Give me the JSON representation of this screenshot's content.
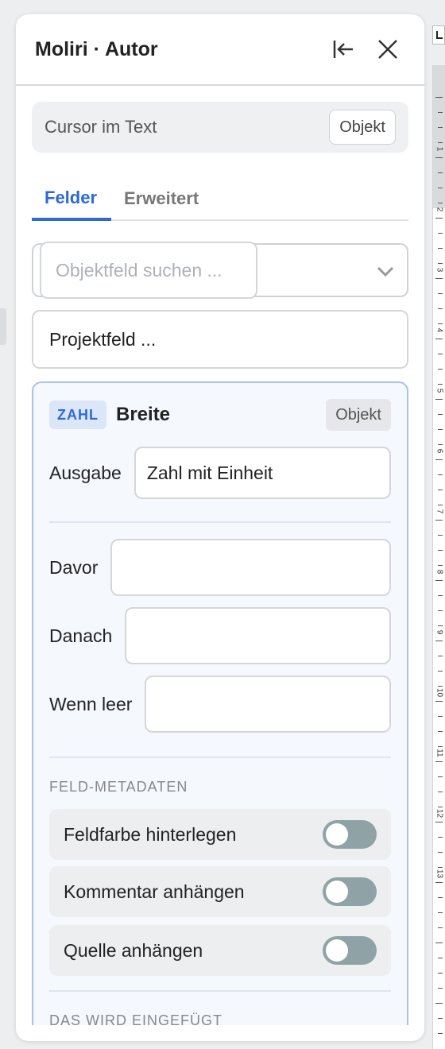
{
  "panel": {
    "title": "Moliri · Autor",
    "context_text": "Cursor im Text",
    "context_button": "Objekt"
  },
  "tabs": [
    {
      "label": "Felder",
      "active": true
    },
    {
      "label": "Erweitert",
      "active": false
    }
  ],
  "search": {
    "placeholder": "Objektfeld suchen ..."
  },
  "project_field": {
    "placeholder": "Projektfeld ..."
  },
  "field_card": {
    "type_badge": "ZAHL",
    "name": "Breite",
    "scope": "Objekt",
    "output_label": "Ausgabe",
    "output_value": "Zahl mit Einheit",
    "before_label": "Davor",
    "before_value": "",
    "after_label": "Danach",
    "after_value": "",
    "empty_label": "Wenn leer",
    "empty_value": "",
    "metadata_title": "FELD-METADATEN",
    "toggles": [
      {
        "label": "Feldfarbe hinterlegen",
        "on": false
      },
      {
        "label": "Kommentar anhängen",
        "on": false
      },
      {
        "label": "Quelle anhängen",
        "on": false
      }
    ],
    "insert_title": "DAS WIRD EINGEFÜGT"
  },
  "ruler": {
    "numbers": [
      "1",
      "2",
      "3",
      "4",
      "5",
      "6",
      "7",
      "8",
      "9",
      "10",
      "11",
      "12",
      "13"
    ]
  },
  "colors": {
    "accent": "#2d6ad8",
    "toggle_off": "#8fa3a6",
    "card_border": "#a9c2ec"
  }
}
